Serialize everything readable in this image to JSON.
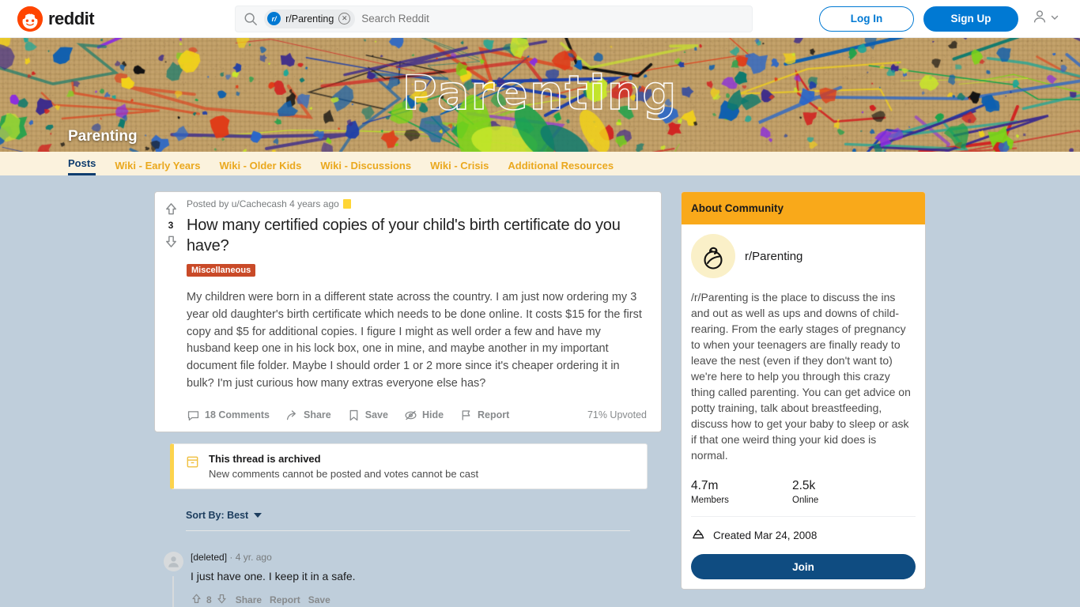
{
  "topnav": {
    "brand": "reddit",
    "search": {
      "chip_label": "r/Parenting",
      "chip_avatar_letter": "r/",
      "placeholder": "Search Reddit",
      "close_glyph": "✕"
    },
    "login_label": "Log In",
    "signup_label": "Sign Up"
  },
  "banner": {
    "community_title": "Parenting",
    "script_text": "Parenting"
  },
  "tabs": [
    {
      "label": "Posts",
      "active": true
    },
    {
      "label": "Wiki - Early Years",
      "active": false
    },
    {
      "label": "Wiki - Older Kids",
      "active": false
    },
    {
      "label": "Wiki - Discussions",
      "active": false
    },
    {
      "label": "Wiki - Crisis",
      "active": false
    },
    {
      "label": "Additional Resources",
      "active": false
    }
  ],
  "post": {
    "score": "3",
    "meta": "Posted by u/Cachecash 4 years ago",
    "title": "How many certified copies of your child's birth certificate do you have?",
    "flair": "Miscellaneous",
    "text": "My children were born in a different state across the country. I am just now ordering my 3 year old daughter's birth certificate which needs to be done online. It costs $15 for the first copy and $5 for additional copies. I figure I might as well order a few and have my husband keep one in his lock box, one in mine, and maybe another in my important document file folder. Maybe I should order 1 or 2 more since it's cheaper ordering it in bulk? I'm just curious how many extras everyone else has?",
    "actions": {
      "comments": "18 Comments",
      "share": "Share",
      "save": "Save",
      "hide": "Hide",
      "report": "Report"
    },
    "upvoted": "71% Upvoted"
  },
  "archived": {
    "title": "This thread is archived",
    "subtitle": "New comments cannot be posted and votes cannot be cast"
  },
  "sort": {
    "label": "Sort By: Best"
  },
  "comments": [
    {
      "author": "[deleted]",
      "separator": "·",
      "age": "4 yr. ago",
      "text": "I just have one. I keep it in a safe.",
      "score": "8",
      "share": "Share",
      "report": "Report",
      "save": "Save"
    }
  ],
  "sidebar": {
    "header": "About Community",
    "community_name": "r/Parenting",
    "description": "/r/Parenting is the place to discuss the ins and out as well as ups and downs of child-rearing. From the early stages of pregnancy to when your teenagers are finally ready to leave the nest (even if they don't want to) we're here to help you through this crazy thing called parenting. You can get advice on potty training, talk about breastfeeding, discuss how to get your baby to sleep or ask if that one weird thing your kid does is normal.",
    "members_count": "4.7m",
    "members_label": "Members",
    "online_count": "2.5k",
    "online_label": "Online",
    "created": "Created Mar 24, 2008",
    "join_label": "Join"
  },
  "colors": {
    "reddit_orange": "#ff4500",
    "accent_blue": "#0079d3",
    "join_blue": "#0f4c81",
    "sidebar_header": "#f9a91a",
    "tab_gold": "#eaa81e",
    "tab_active": "#0f3d6e",
    "flair_red": "#c94a28",
    "page_bg": "#bfcedb",
    "tabstrip_bg": "#fbf2dd"
  }
}
